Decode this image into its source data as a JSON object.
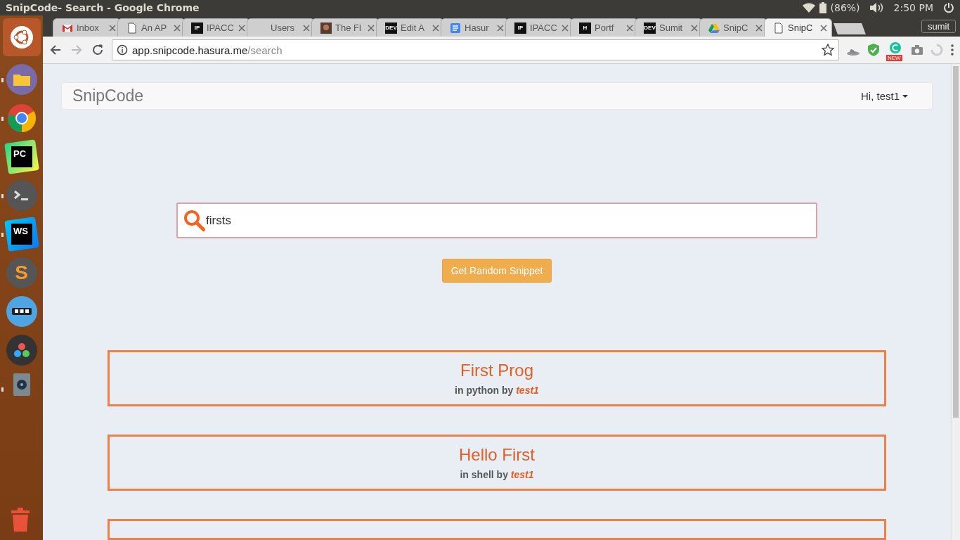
{
  "top_bar": {
    "title": "SnipCode- Search - Google Chrome",
    "battery": "(86%)",
    "time": "2:50 PM"
  },
  "launcher": [
    {
      "kind": "ubuntu",
      "running": false
    },
    {
      "kind": "files",
      "running": true
    },
    {
      "kind": "chrome",
      "running": true
    },
    {
      "kind": "pycharm",
      "label": "PC",
      "running": false
    },
    {
      "kind": "terminal",
      "running": true
    },
    {
      "kind": "webstorm",
      "label": "WS",
      "running": true
    },
    {
      "kind": "sublime",
      "label": "S",
      "running": false
    },
    {
      "kind": "dots",
      "running": false
    },
    {
      "kind": "gears",
      "running": false
    },
    {
      "kind": "disk",
      "running": true
    }
  ],
  "tabs": [
    {
      "kind": "gmail",
      "label": "Inbox",
      "selected": false
    },
    {
      "kind": "page",
      "label": "An AP",
      "selected": false
    },
    {
      "kind": "badge",
      "icon_text": "IP",
      "label": "IPACC",
      "selected": false
    },
    {
      "kind": "blank",
      "label": "Users",
      "selected": false
    },
    {
      "kind": "photo",
      "label": "The Fl",
      "selected": false
    },
    {
      "kind": "badge",
      "icon_text": "DEV",
      "label": "Edit A",
      "selected": false
    },
    {
      "kind": "docs",
      "label": "Hasur",
      "selected": false
    },
    {
      "kind": "badge",
      "icon_text": "IP",
      "label": "IPACC",
      "selected": false
    },
    {
      "kind": "badge",
      "icon_text": "H",
      "label": "Portf",
      "selected": false
    },
    {
      "kind": "badge",
      "icon_text": "DEV",
      "label": "Sumit",
      "selected": false
    },
    {
      "kind": "drive",
      "label": "SnipC",
      "selected": false
    },
    {
      "kind": "page",
      "label": "SnipC",
      "selected": true
    }
  ],
  "profile": "sumit",
  "address_bar": {
    "host": "app.snipcode.hasura.me",
    "path": "/search"
  },
  "extension_badge": "NEW",
  "navbar": {
    "brand": "SnipCode",
    "user_menu": "Hi, test1"
  },
  "search": {
    "value": "firsts"
  },
  "random_button": "Get Random Snippet",
  "results": [
    {
      "title": "First Prog",
      "meta": "in python by",
      "author": "test1"
    },
    {
      "title": "Hello First",
      "meta": "in shell by",
      "author": "test1"
    }
  ],
  "more_results_cut_off": true
}
